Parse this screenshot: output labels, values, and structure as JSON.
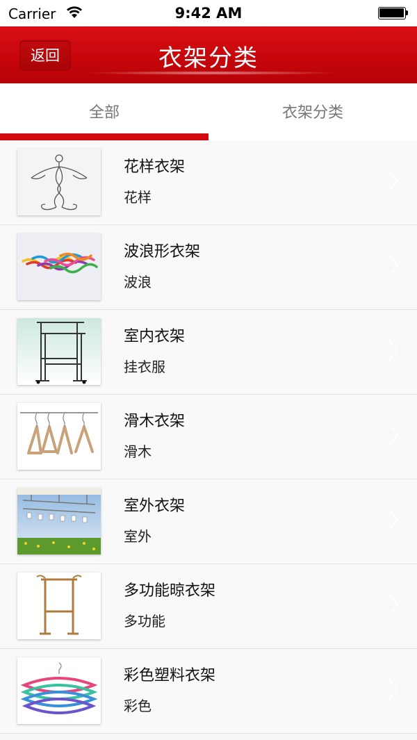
{
  "status_bar": {
    "carrier": "Carrier",
    "time": "9:42 AM"
  },
  "nav": {
    "back_label": "返回",
    "title": "衣架分类"
  },
  "tabs": [
    {
      "label": "全部",
      "active": true
    },
    {
      "label": "衣架分类",
      "active": false
    }
  ],
  "colors": {
    "brand_red": "#c6060b",
    "indicator": "#d10a0f"
  },
  "items": [
    {
      "title": "花样衣架",
      "subtitle": "花样",
      "image": "wire-figure-hanger"
    },
    {
      "title": "波浪形衣架",
      "subtitle": "波浪",
      "image": "colorful-wave-hangers"
    },
    {
      "title": "室内衣架",
      "subtitle": "挂衣服",
      "image": "indoor-rack"
    },
    {
      "title": "滑木衣架",
      "subtitle": "滑木",
      "image": "wooden-hangers"
    },
    {
      "title": "室外衣架",
      "subtitle": "室外",
      "image": "outdoor-rack"
    },
    {
      "title": "多功能晾衣架",
      "subtitle": "多功能",
      "image": "wooden-stand"
    },
    {
      "title": "彩色塑料衣架",
      "subtitle": "彩色",
      "image": "plastic-hangers"
    }
  ]
}
